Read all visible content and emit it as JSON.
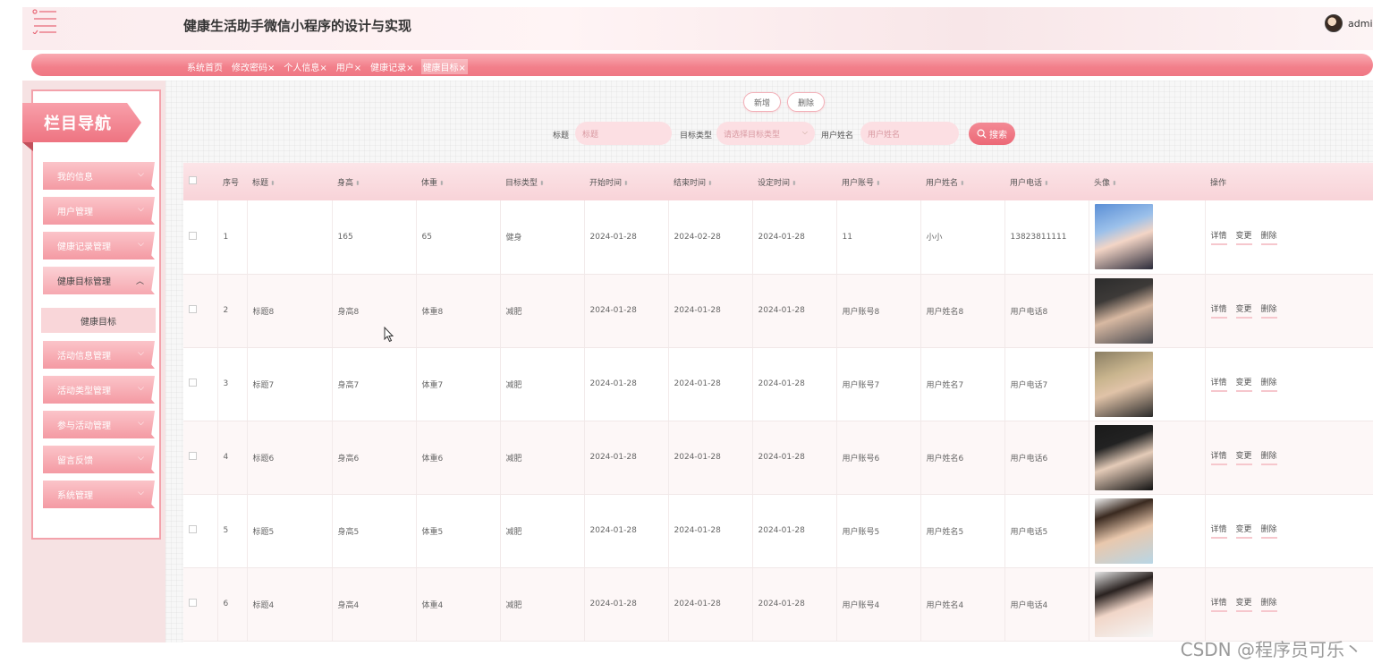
{
  "app": {
    "title": "健康生活助手微信小程序的设计与实现",
    "user_name": "admin"
  },
  "tabs": [
    {
      "label": "系统首页"
    },
    {
      "label": "修改密码×"
    },
    {
      "label": "个人信息×"
    },
    {
      "label": "用户×"
    },
    {
      "label": "健康记录×"
    },
    {
      "label": "健康目标×",
      "active": true
    }
  ],
  "sidebar": {
    "title": "栏目导航",
    "items": [
      {
        "label": "我的信息"
      },
      {
        "label": "用户管理"
      },
      {
        "label": "健康记录管理"
      },
      {
        "label": "健康目标管理",
        "open": true
      },
      {
        "label": "活动信息管理"
      },
      {
        "label": "活动类型管理"
      },
      {
        "label": "参与活动管理"
      },
      {
        "label": "留言反馈"
      },
      {
        "label": "系统管理"
      }
    ],
    "sub_item": "健康目标"
  },
  "toolbar": {
    "add_label": "新增",
    "delete_label": "删除"
  },
  "search": {
    "title_label": "标题",
    "title_placeholder": "标题",
    "type_label": "目标类型",
    "type_placeholder": "请选择目标类型",
    "username_label": "用户姓名",
    "username_placeholder": "用户姓名",
    "button_label": "搜索"
  },
  "table": {
    "headers": [
      "序号",
      "标题",
      "身高",
      "体重",
      "目标类型",
      "开始时间",
      "结束时间",
      "设定时间",
      "用户账号",
      "用户姓名",
      "用户电话",
      "头像",
      "操作"
    ],
    "rows": [
      [
        "1",
        "",
        "165",
        "65",
        "健身",
        "2024-01-28",
        "2024-02-28",
        "2024-01-28",
        "11",
        "小小",
        "13823811111"
      ],
      [
        "2",
        "标题8",
        "身高8",
        "体重8",
        "减肥",
        "2024-01-28",
        "2024-01-28",
        "2024-01-28",
        "用户账号8",
        "用户姓名8",
        "用户电话8"
      ],
      [
        "3",
        "标题7",
        "身高7",
        "体重7",
        "减肥",
        "2024-01-28",
        "2024-01-28",
        "2024-01-28",
        "用户账号7",
        "用户姓名7",
        "用户电话7"
      ],
      [
        "4",
        "标题6",
        "身高6",
        "体重6",
        "减肥",
        "2024-01-28",
        "2024-01-28",
        "2024-01-28",
        "用户账号6",
        "用户姓名6",
        "用户电话6"
      ],
      [
        "5",
        "标题5",
        "身高5",
        "体重5",
        "减肥",
        "2024-01-28",
        "2024-01-28",
        "2024-01-28",
        "用户账号5",
        "用户姓名5",
        "用户电话5"
      ],
      [
        "6",
        "标题4",
        "身高4",
        "体重4",
        "减肥",
        "2024-01-28",
        "2024-01-28",
        "2024-01-28",
        "用户账号4",
        "用户姓名4",
        "用户电话4"
      ]
    ],
    "actions": [
      "详情",
      "变更",
      "删除"
    ]
  },
  "watermark": "CSDN @程序员可乐丶",
  "colors": {
    "accent": "#ef7784",
    "accent_light": "#fcdfe3",
    "sidebar_border": "#f3a2ab"
  }
}
